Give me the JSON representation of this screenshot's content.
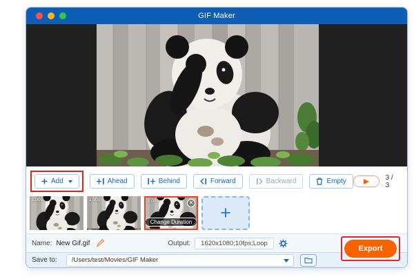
{
  "window": {
    "title": "GIF Maker"
  },
  "toolbar": {
    "add": {
      "label": "Add"
    },
    "ahead": {
      "label": "Ahead"
    },
    "behind": {
      "label": "Behind"
    },
    "forward": {
      "label": "Forward"
    },
    "backward": {
      "label": "Backward",
      "disabled": true
    },
    "empty": {
      "label": "Empty"
    },
    "frame_counter": {
      "current": 3,
      "total": 3,
      "display": "3 / 3"
    }
  },
  "timeline": {
    "frames": [
      {
        "duration": "1.00s",
        "selected": false
      },
      {
        "duration": "1.00s",
        "selected": false
      },
      {
        "duration": "1.00s",
        "selected": true,
        "change_duration_label": "Change Duration",
        "close_glyph": "✕"
      }
    ],
    "add_tile_glyph": "+"
  },
  "output_bar": {
    "name_label": "Name:",
    "name_value": "New Gif.gif",
    "output_label": "Output:",
    "output_value": "1620x1080;10fps;Loop",
    "export_label": "Export"
  },
  "save_bar": {
    "save_to_label": "Save to:",
    "path_value": "/Users/test/Movies/GIF Maker"
  },
  "icons": {
    "titlebar": [
      "close-light",
      "minimize-light",
      "zoom-light"
    ],
    "toolbar": [
      "plus-icon",
      "caret-down-icon",
      "add-ahead-icon",
      "add-behind-icon",
      "move-forward-icon",
      "move-backward-icon",
      "trash-icon"
    ],
    "bottom": [
      "pencil-icon",
      "gear-icon",
      "dropdown-arrow-icon",
      "folder-icon",
      "play-icon",
      "close-icon"
    ]
  },
  "colors": {
    "titlebar_blue": "#0d5eb4",
    "accent_blue": "#1565c0",
    "button_border_blue": "#a6c9ea",
    "highlight_red": "#e42318",
    "selected_thumb_red": "#e8442a",
    "export_orange": "#f86300",
    "preview_background": "#212121",
    "save_bar_background": "#e7f1fb"
  }
}
